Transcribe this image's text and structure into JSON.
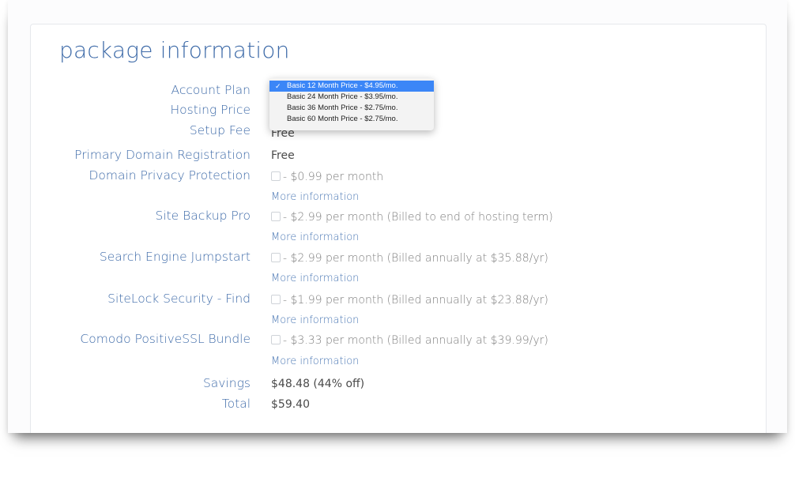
{
  "section": {
    "title": "package information"
  },
  "rows": {
    "account_plan": {
      "label": "Account Plan"
    },
    "hosting_price": {
      "label": "Hosting Price"
    },
    "setup_fee": {
      "label": "Setup Fee",
      "value": "Free"
    },
    "primary_domain": {
      "label": "Primary Domain Registration",
      "value": "Free"
    },
    "domain_privacy": {
      "label": "Domain Privacy Protection",
      "value": "- $0.99 per month",
      "more": "More information"
    },
    "site_backup": {
      "label": "Site Backup Pro",
      "value": "- $2.99 per month (Billed to end of hosting term)",
      "more": "More information"
    },
    "search_engine": {
      "label": "Search Engine Jumpstart",
      "value": "- $2.99 per month (Billed annually at $35.88/yr)",
      "more": "More information"
    },
    "sitelock": {
      "label": "SiteLock Security - Find",
      "value": "- $1.99 per month (Billed annually at $23.88/yr)",
      "more": "More information"
    },
    "comodo": {
      "label": "Comodo PositiveSSL Bundle",
      "value": "- $3.33 per month (Billed annually at $39.99/yr)",
      "more": "More information"
    },
    "savings": {
      "label": "Savings",
      "value": "$48.48 (44% off)"
    },
    "total": {
      "label": "Total",
      "value": "$59.40"
    }
  },
  "plan_dropdown": {
    "selected_index": 0,
    "check_glyph": "✓",
    "options": [
      "Basic 12 Month Price - $4.95/mo.",
      "Basic 24 Month Price - $3.95/mo.",
      "Basic 36 Month Price - $2.75/mo.",
      "Basic 60 Month Price - $2.75/mo."
    ]
  },
  "colors": {
    "label_blue": "#3d6aa8",
    "link_blue": "#4a77b4",
    "selected_option": "#3b86f7"
  }
}
